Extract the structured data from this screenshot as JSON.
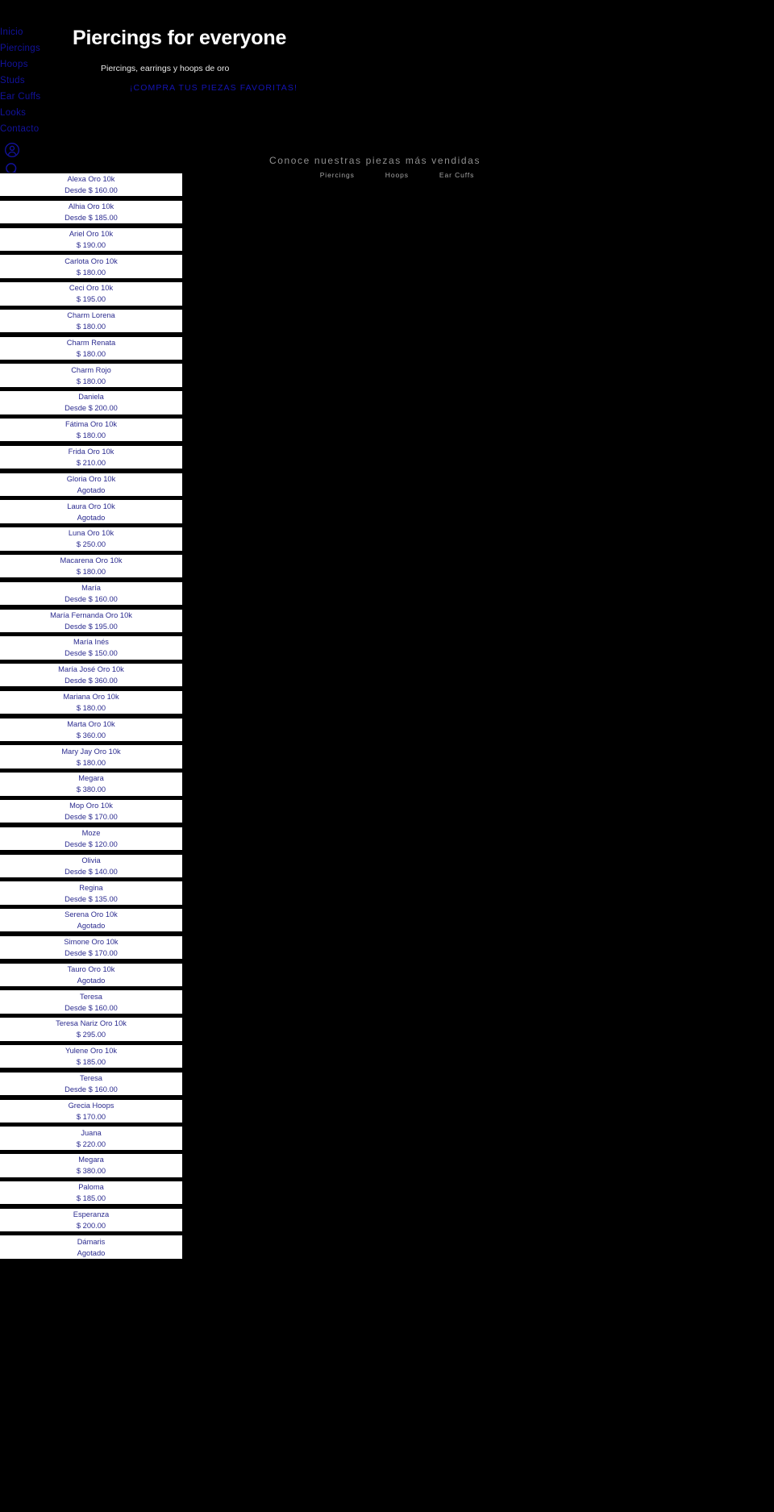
{
  "sidebar": {
    "items": [
      {
        "label": "Inicio",
        "name": "inicio"
      },
      {
        "label": "Piercings",
        "name": "piercings"
      },
      {
        "label": "Hoops",
        "name": "hoops"
      },
      {
        "label": "Studs",
        "name": "studs"
      },
      {
        "label": "Ear Cuffs",
        "name": "ear-cuffs"
      },
      {
        "label": "Looks",
        "name": "looks"
      },
      {
        "label": "Contacto",
        "name": "contacto"
      }
    ],
    "icons": [
      {
        "name": "account-icon"
      },
      {
        "name": "search-icon"
      },
      {
        "name": "shopping-bag-icon"
      }
    ],
    "link_color": "#12129c"
  },
  "hero": {
    "title": "Piercings for everyone",
    "subtitle": "Piercings, earrings y hoops de oro",
    "cta": "¡COMPRA TUS PIEZAS FAVORITAS!",
    "cta_color": "#1414b4",
    "title_color": "#ffffff"
  },
  "banner": {
    "heading": "Conoce nuestras piezas más vendidas",
    "links": [
      {
        "label": "Piercings"
      },
      {
        "label": "Hoops"
      },
      {
        "label": "Ear Cuffs"
      }
    ]
  },
  "products": [
    {
      "title": "Alexa Oro 10k",
      "price": "Desde $ 160.00"
    },
    {
      "title": "Alhia Oro 10k",
      "price": "Desde $ 185.00"
    },
    {
      "title": "Ariel Oro 10k",
      "price": "$ 190.00"
    },
    {
      "title": "Carlota Oro 10k",
      "price": "$ 180.00"
    },
    {
      "title": "Ceci Oro 10k",
      "price": "$ 195.00"
    },
    {
      "title": "Charm Lorena",
      "price": "$ 180.00"
    },
    {
      "title": "Charm Renata",
      "price": "$ 180.00"
    },
    {
      "title": "Charm Rojo",
      "price": "$ 180.00"
    },
    {
      "title": "Daniela",
      "price": "Desde $ 200.00"
    },
    {
      "title": "Fátima Oro 10k",
      "price": "$ 180.00"
    },
    {
      "title": "Frida Oro 10k",
      "price": "$ 210.00"
    },
    {
      "title": "Gloria Oro 10k",
      "price": "Agotado"
    },
    {
      "title": "Laura Oro 10k",
      "price": "Agotado"
    },
    {
      "title": "Luna Oro 10k",
      "price": "$ 250.00"
    },
    {
      "title": "Macarena Oro 10k",
      "price": "$ 180.00"
    },
    {
      "title": "María",
      "price": "Desde $ 160.00"
    },
    {
      "title": "María Fernanda Oro 10k",
      "price": "Desde $ 195.00"
    },
    {
      "title": "María Inés",
      "price": "Desde $ 150.00"
    },
    {
      "title": "María José Oro 10k",
      "price": "Desde $ 360.00"
    },
    {
      "title": "Mariana Oro 10k",
      "price": "$ 180.00"
    },
    {
      "title": "Marta Oro 10k",
      "price": "$ 360.00"
    },
    {
      "title": "Mary Jay Oro 10k",
      "price": "$ 180.00"
    },
    {
      "title": "Megara",
      "price": "$ 380.00"
    },
    {
      "title": "Mop Oro 10k",
      "price": "Desde $ 170.00"
    },
    {
      "title": "Moze",
      "price": "Desde $ 120.00"
    },
    {
      "title": "Olivia",
      "price": "Desde $ 140.00"
    },
    {
      "title": "Regina",
      "price": "Desde $ 135.00"
    },
    {
      "title": "Serena Oro 10k",
      "price": "Agotado"
    },
    {
      "title": "Simone Oro 10k",
      "price": "Desde $ 170.00"
    },
    {
      "title": "Tauro Oro 10k",
      "price": "Agotado"
    },
    {
      "title": "Teresa",
      "price": "Desde $ 160.00"
    },
    {
      "title": "Teresa Nariz Oro 10k",
      "price": "$ 295.00"
    },
    {
      "title": "Yulene Oro 10k",
      "price": "$ 185.00"
    },
    {
      "title": "Teresa",
      "price": "Desde $ 160.00"
    },
    {
      "title": "Grecia Hoops",
      "price": "$ 170.00"
    },
    {
      "title": "Juana",
      "price": "$ 220.00"
    },
    {
      "title": "Megara",
      "price": "$ 380.00"
    },
    {
      "title": "Paloma",
      "price": "$ 185.00"
    },
    {
      "title": "Esperanza",
      "price": "$ 200.00"
    },
    {
      "title": "Dámaris",
      "price": "Agotado"
    }
  ]
}
